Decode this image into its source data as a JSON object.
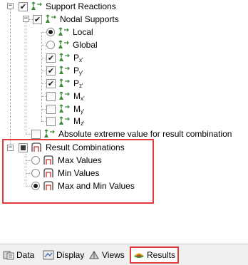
{
  "tree": {
    "support_reactions": "Support Reactions",
    "nodal_supports": "Nodal Supports",
    "local": "Local",
    "global": "Global",
    "px": {
      "base": "P",
      "sub": "x'"
    },
    "py": {
      "base": "P",
      "sub": "y'"
    },
    "pz": {
      "base": "P",
      "sub": "z'"
    },
    "mx": {
      "base": "M",
      "sub": "x'"
    },
    "my": {
      "base": "M",
      "sub": "y'"
    },
    "mz": {
      "base": "M",
      "sub": "z'"
    },
    "abs_extreme": "Absolute extreme value for result combination",
    "result_combinations": "Result Combinations",
    "max_values": "Max Values",
    "min_values": "Min Values",
    "max_min_values": "Max and Min Values"
  },
  "tabs": {
    "data": "Data",
    "display": "Display",
    "views": "Views",
    "results": "Results"
  },
  "colors": {
    "highlight": "#e23b3b",
    "support_icon": "#3a8a3a"
  },
  "icons": {
    "support": "support-icon",
    "combination": "combination-icon"
  }
}
